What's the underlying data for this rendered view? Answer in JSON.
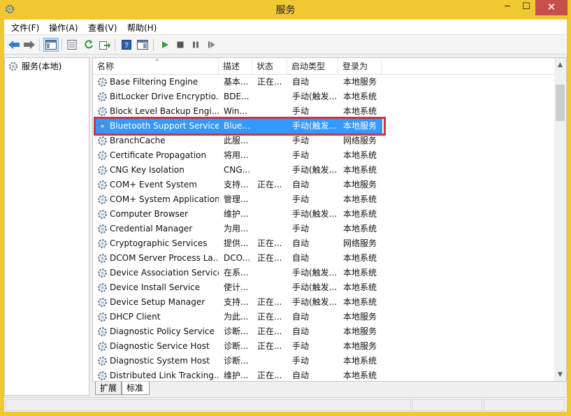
{
  "window": {
    "title": "服务",
    "min": "─",
    "max": "☐",
    "close": "✕"
  },
  "menu": [
    "文件(F)",
    "操作(A)",
    "查看(V)",
    "帮助(H)"
  ],
  "tree": {
    "root": "服务(本地)"
  },
  "columns": {
    "name": "名称",
    "desc": "描述",
    "status": "状态",
    "startup": "启动类型",
    "logon": "登录为"
  },
  "services": [
    {
      "name": "Base Filtering Engine",
      "desc": "基本...",
      "status": "正在...",
      "startup": "自动",
      "logon": "本地服务"
    },
    {
      "name": "BitLocker Drive Encryptio...",
      "desc": "BDE...",
      "status": "",
      "startup": "手动(触发...",
      "logon": "本地系统"
    },
    {
      "name": "Block Level Backup Engi...",
      "desc": "Win...",
      "status": "",
      "startup": "手动",
      "logon": "本地系统"
    },
    {
      "name": "Bluetooth Support Service",
      "desc": "Blue...",
      "status": "",
      "startup": "手动(触发...",
      "logon": "本地服务"
    },
    {
      "name": "BranchCache",
      "desc": "此服...",
      "status": "",
      "startup": "手动",
      "logon": "网络服务"
    },
    {
      "name": "Certificate Propagation",
      "desc": "将用...",
      "status": "",
      "startup": "手动",
      "logon": "本地系统"
    },
    {
      "name": "CNG Key Isolation",
      "desc": "CNG...",
      "status": "",
      "startup": "手动(触发...",
      "logon": "本地系统"
    },
    {
      "name": "COM+ Event System",
      "desc": "支持...",
      "status": "正在...",
      "startup": "自动",
      "logon": "本地服务"
    },
    {
      "name": "COM+ System Application",
      "desc": "管理...",
      "status": "",
      "startup": "手动",
      "logon": "本地系统"
    },
    {
      "name": "Computer Browser",
      "desc": "维护...",
      "status": "",
      "startup": "手动(触发...",
      "logon": "本地系统"
    },
    {
      "name": "Credential Manager",
      "desc": "为用...",
      "status": "",
      "startup": "手动",
      "logon": "本地系统"
    },
    {
      "name": "Cryptographic Services",
      "desc": "提供...",
      "status": "正在...",
      "startup": "自动",
      "logon": "网络服务"
    },
    {
      "name": "DCOM Server Process La...",
      "desc": "DCO...",
      "status": "正在...",
      "startup": "自动",
      "logon": "本地系统"
    },
    {
      "name": "Device Association Service",
      "desc": "在系...",
      "status": "",
      "startup": "手动(触发...",
      "logon": "本地系统"
    },
    {
      "name": "Device Install Service",
      "desc": "使计...",
      "status": "",
      "startup": "手动(触发...",
      "logon": "本地系统"
    },
    {
      "name": "Device Setup Manager",
      "desc": "支持...",
      "status": "正在...",
      "startup": "手动(触发...",
      "logon": "本地系统"
    },
    {
      "name": "DHCP Client",
      "desc": "为此...",
      "status": "正在...",
      "startup": "自动",
      "logon": "本地服务"
    },
    {
      "name": "Diagnostic Policy Service",
      "desc": "诊断...",
      "status": "正在...",
      "startup": "自动",
      "logon": "本地服务"
    },
    {
      "name": "Diagnostic Service Host",
      "desc": "诊断...",
      "status": "正在...",
      "startup": "手动",
      "logon": "本地服务"
    },
    {
      "name": "Diagnostic System Host",
      "desc": "诊断...",
      "status": "",
      "startup": "手动",
      "logon": "本地系统"
    },
    {
      "name": "Distributed Link Tracking...",
      "desc": "维护...",
      "status": "正在...",
      "startup": "自动",
      "logon": "本地系统"
    }
  ],
  "selected_index": 3,
  "tabs": {
    "extended": "扩展",
    "standard": "标准"
  },
  "colors": {
    "titlebar": "#f0c832",
    "selection": "#3399ff",
    "highlight": "#d8313a",
    "close": "#c7504a"
  }
}
